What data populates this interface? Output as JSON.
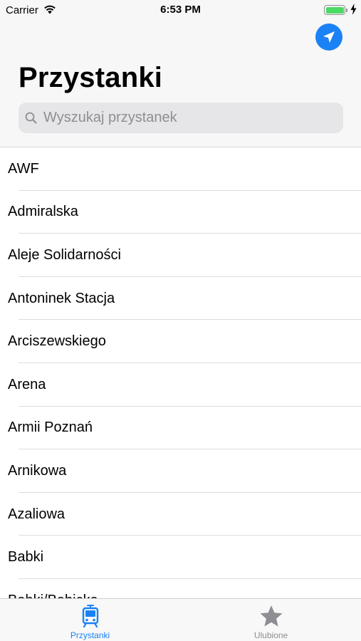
{
  "status_bar": {
    "carrier": "Carrier",
    "time": "6:53 PM",
    "battery_level": 1.0
  },
  "header": {
    "title": "Przystanki",
    "location_button_icon": "location-arrow-icon"
  },
  "search": {
    "placeholder": "Wyszukaj przystanek",
    "value": ""
  },
  "stops": [
    "AWF",
    "Admiralska",
    "Aleje Solidarności",
    "Antoninek Stacja",
    "Arciszewskiego",
    "Arena",
    "Armii Poznań",
    "Arnikowa",
    "Azaliowa",
    "Babki",
    "Babki/Babicka"
  ],
  "tab_bar": {
    "tabs": [
      {
        "label": "Przystanki",
        "icon": "tram-icon",
        "active": true
      },
      {
        "label": "Ulubione",
        "icon": "star-icon",
        "active": false
      }
    ]
  },
  "colors": {
    "accent": "#1a82f5",
    "inactive": "#8e8e93",
    "battery": "#4cd964"
  }
}
